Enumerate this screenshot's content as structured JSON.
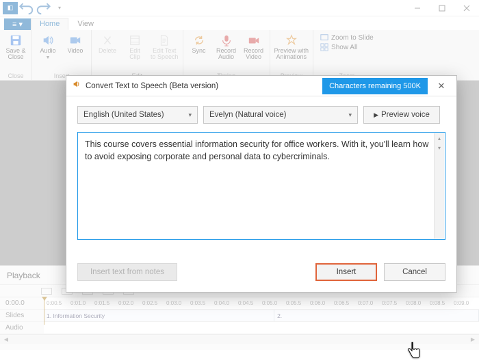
{
  "titlebar": {
    "window_controls": {
      "min": "—",
      "max": "□",
      "close": "✕"
    }
  },
  "tabs": {
    "file": "≡ ▾",
    "home": "Home",
    "view": "View"
  },
  "ribbon": {
    "close": {
      "save_close": "Save &\nClose",
      "group": "Close"
    },
    "insert": {
      "audio": "Audio",
      "video": "Video",
      "group": "Insert"
    },
    "edit": {
      "delete": "Delete",
      "edit_clip": "Edit\nClip",
      "edit_tts": "Edit Text\nto Speech",
      "group": "Edit"
    },
    "timing": {
      "sync": "Sync",
      "rec_audio": "Record\nAudio",
      "rec_video": "Record\nVideo",
      "group": "Timing"
    },
    "preview": {
      "preview_anim": "Preview with\nAnimations",
      "group": "Preview"
    },
    "zoom": {
      "zoom_slide": "Zoom to Slide",
      "show_all": "Show All",
      "group": "Zoom"
    }
  },
  "playback": {
    "title": "Playback",
    "labels": {
      "time": "0:00.0",
      "slides": "Slides",
      "audio": "Audio"
    },
    "ticks": [
      "0:00.5",
      "0:01.0",
      "0:01.5",
      "0:02.0",
      "0:02.5",
      "0:03.0",
      "0:03.5",
      "0:04.0",
      "0:04.5",
      "0:05.0",
      "0:05.5",
      "0:06.0",
      "0:06.5",
      "0:07.0",
      "0:07.5",
      "0:08.0",
      "0:08.5",
      "0:09.0"
    ],
    "slides": {
      "s1": "1. Information Security",
      "s2": "2."
    }
  },
  "dialog": {
    "title": "Convert Text to Speech (Beta version)",
    "badge": "Characters remaining 500K",
    "language": "English (United States)",
    "voice": "Evelyn (Natural voice)",
    "preview_voice": "Preview voice",
    "text": "This course covers essential information security for office workers. With it, you'll learn how to avoid exposing corporate and personal data to cybercriminals.",
    "notes_btn": "Insert text from notes",
    "insert": "Insert",
    "cancel": "Cancel"
  }
}
